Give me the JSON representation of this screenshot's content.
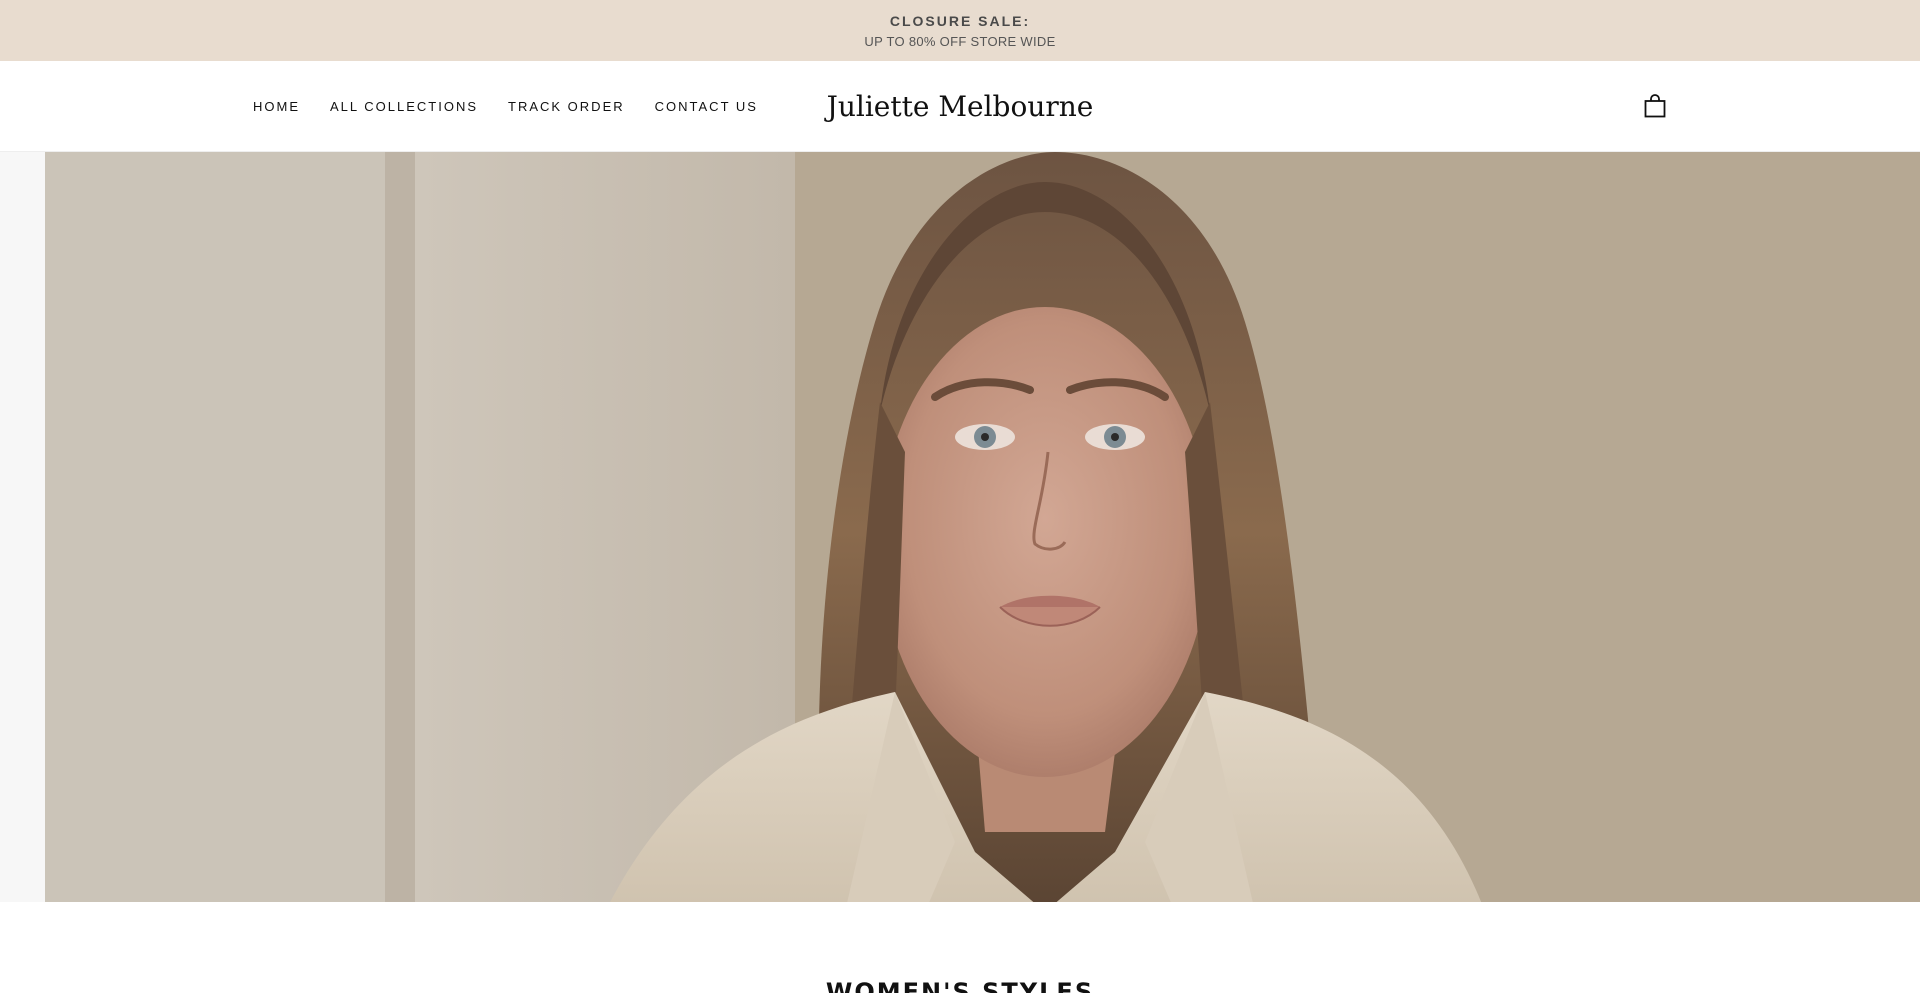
{
  "announcement": {
    "title": "CLOSURE SALE:",
    "subtitle": "UP TO 80% OFF STORE WIDE"
  },
  "nav": {
    "items": [
      "HOME",
      "ALL COLLECTIONS",
      "TRACK ORDER",
      "CONTACT US"
    ]
  },
  "brand": {
    "name": "Juliette Melbourne"
  },
  "cart": {
    "icon": "shopping-bag-icon"
  },
  "hero": {
    "image": "portrait of a woman with long hair in a cream blazer"
  },
  "section": {
    "title": "WOMEN'S STYLES"
  },
  "colors": {
    "announcement_bg": "#e8dccf",
    "text": "#111111"
  }
}
